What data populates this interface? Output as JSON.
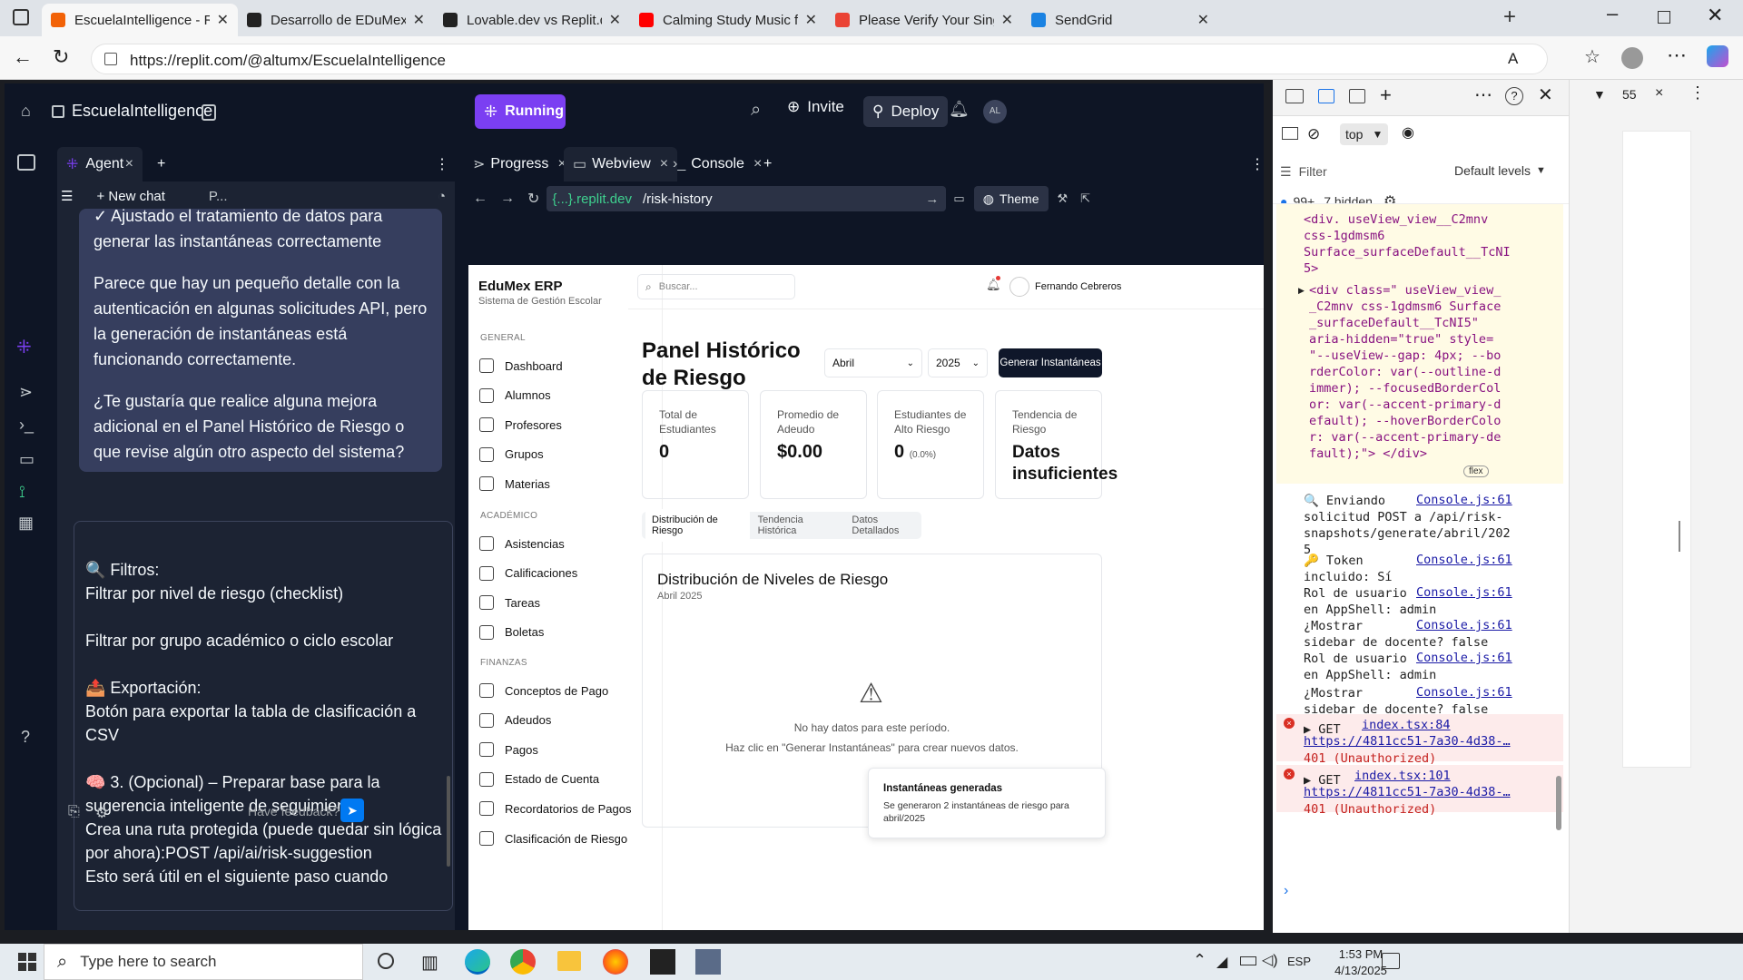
{
  "browser": {
    "tabs": [
      {
        "title": "EscuelaIntelligence - Replit",
        "color": "#f26207",
        "active": true
      },
      {
        "title": "Desarrollo de EDuMex ERP E",
        "color": "#222"
      },
      {
        "title": "Lovable.dev vs Replit.dev",
        "color": "#222"
      },
      {
        "title": "Calming Study Music for Kid",
        "color": "#ff0000"
      },
      {
        "title": "Please Verify Your Single Sen",
        "color": "#ea4335"
      },
      {
        "title": "SendGrid",
        "color": "#1a82e2"
      }
    ],
    "url": "https://replit.com/@altumx/EscuelaIntelligence"
  },
  "replit": {
    "project": "EscuelaIntelligence",
    "running": "Running",
    "invite": "Invite",
    "deploy": "Deploy",
    "avatar": "AL",
    "agent_tab": "Agent",
    "new_chat": "New chat",
    "chat_select": "P...",
    "messages": [
      "✓ Ajustado el tratamiento de datos para generar las instantáneas correctamente",
      "Parece que hay un pequeño detalle con la autenticación en algunas solicitudes API, pero la generación de instantáneas está funcionando correctamente.",
      "¿Te gustaría que realice alguna mejora adicional en el Panel Histórico de Riesgo o que revise algún otro aspecto del sistema?"
    ],
    "input_text": "🔍 Filtros:\nFiltrar por nivel de riesgo (checklist)\n\nFiltrar por grupo académico o ciclo escolar\n\n📤 Exportación:\nBotón para exportar la tabla de clasificación a CSV\n\n🧠 3. (Opcional) – Preparar base para la sugerencia inteligente de seguimiento\nCrea una ruta protegida (puede quedar sin lógica por ahora):POST /api/ai/risk-suggestion\nEsto será útil en el siguiente paso cuando",
    "feedback": "Have feedback?",
    "pane_tabs": [
      "Progress",
      "Webview",
      "Console"
    ],
    "wv_host": "{...}.replit.dev",
    "wv_path": "/risk-history",
    "theme": "Theme"
  },
  "app": {
    "brand": "EduMex ERP",
    "brand_sub": "Sistema de Gestión Escolar",
    "search_placeholder": "Buscar...",
    "user": "Fernando Cebreros",
    "sections": {
      "general": "GENERAL",
      "academico": "ACADÉMICO",
      "finanzas": "FINANZAS"
    },
    "nav_general": [
      "Dashboard",
      "Alumnos",
      "Profesores",
      "Grupos",
      "Materias"
    ],
    "nav_academico": [
      "Asistencias",
      "Calificaciones",
      "Tareas",
      "Boletas"
    ],
    "nav_finanzas": [
      "Conceptos de Pago",
      "Adeudos",
      "Pagos",
      "Estado de Cuenta",
      "Recordatorios de Pagos",
      "Clasificación de Riesgo"
    ],
    "page_title": "Panel Histórico de Riesgo",
    "month": "Abril",
    "year": "2025",
    "generate": "Generar Instantáneas",
    "cards": [
      {
        "label": "Total de Estudiantes",
        "value": "0"
      },
      {
        "label": "Promedio de Adeudo",
        "value": "$0.00"
      },
      {
        "label": "Estudiantes de Alto Riesgo",
        "value": "0",
        "extra": "(0.0%)"
      },
      {
        "label": "Tendencia de Riesgo",
        "value": "Datos insuficientes"
      }
    ],
    "tabs": [
      "Distribución de Riesgo",
      "Tendencia Histórica",
      "Datos Detallados"
    ],
    "panel_title": "Distribución de Niveles de Riesgo",
    "panel_sub": "Abril 2025",
    "empty1": "No hay datos para este período.",
    "empty2": "Haz clic en \"Generar Instantáneas\" para crear nuevos datos.",
    "toast_title": "Instantáneas generadas",
    "toast_body": "Se generaron 2 instantáneas de riesgo para abril/2025"
  },
  "devtools": {
    "context": "top",
    "filter": "Filter",
    "levels": "Default levels",
    "count": "99+",
    "hidden": "7 hidden",
    "side_value": "55",
    "element": "<div. useView_view__C2mnv\ncss-1gdmsm6\nSurface_surfaceDefault__TcNI\n5>",
    "element2": "<div class=\" useView_view_\n_C2mnv css-1gdmsm6 Surface\n_surfaceDefault__TcNI5\"\naria-hidden=\"true\" style=\n\"--useView--gap: 4px; --bo\nrderColor: var(--outline-d\nimmer); --focusedBorderCol\nor: var(--accent-primary-d\nefault); --hoverBorderColo\nr: var(--accent-primary-de\nfault);\"> </div>",
    "flex": "flex",
    "logs": [
      {
        "text": "🔍 Enviando\nsolicitud POST a /api/risk-\nsnapshots/generate/abril/202\n5",
        "src": "Console.js:61"
      },
      {
        "text": "🔑 Token\nincluido: Sí",
        "src": "Console.js:61"
      },
      {
        "text": "Rol de usuario\nen AppShell: admin",
        "src": "Console.js:61"
      },
      {
        "text": "¿Mostrar\nsidebar de docente? false",
        "src": "Console.js:61"
      },
      {
        "text": "Rol de usuario\nen AppShell: admin",
        "src": "Console.js:61"
      },
      {
        "text": "¿Mostrar\nsidebar de docente? false",
        "src": "Console.js:61"
      }
    ],
    "errors": [
      {
        "method": "GET",
        "src": "index.tsx:84",
        "url": "https://4811cc51-7a30-4d38-…",
        "status": "401 (Unauthorized)"
      },
      {
        "method": "GET",
        "src": "index.tsx:101",
        "url": "https://4811cc51-7a30-4d38-…",
        "status": "401 (Unauthorized)"
      }
    ]
  },
  "taskbar": {
    "search": "Type here to search",
    "time": "1:53 PM",
    "date": "4/13/2025",
    "lang": "ESP"
  }
}
